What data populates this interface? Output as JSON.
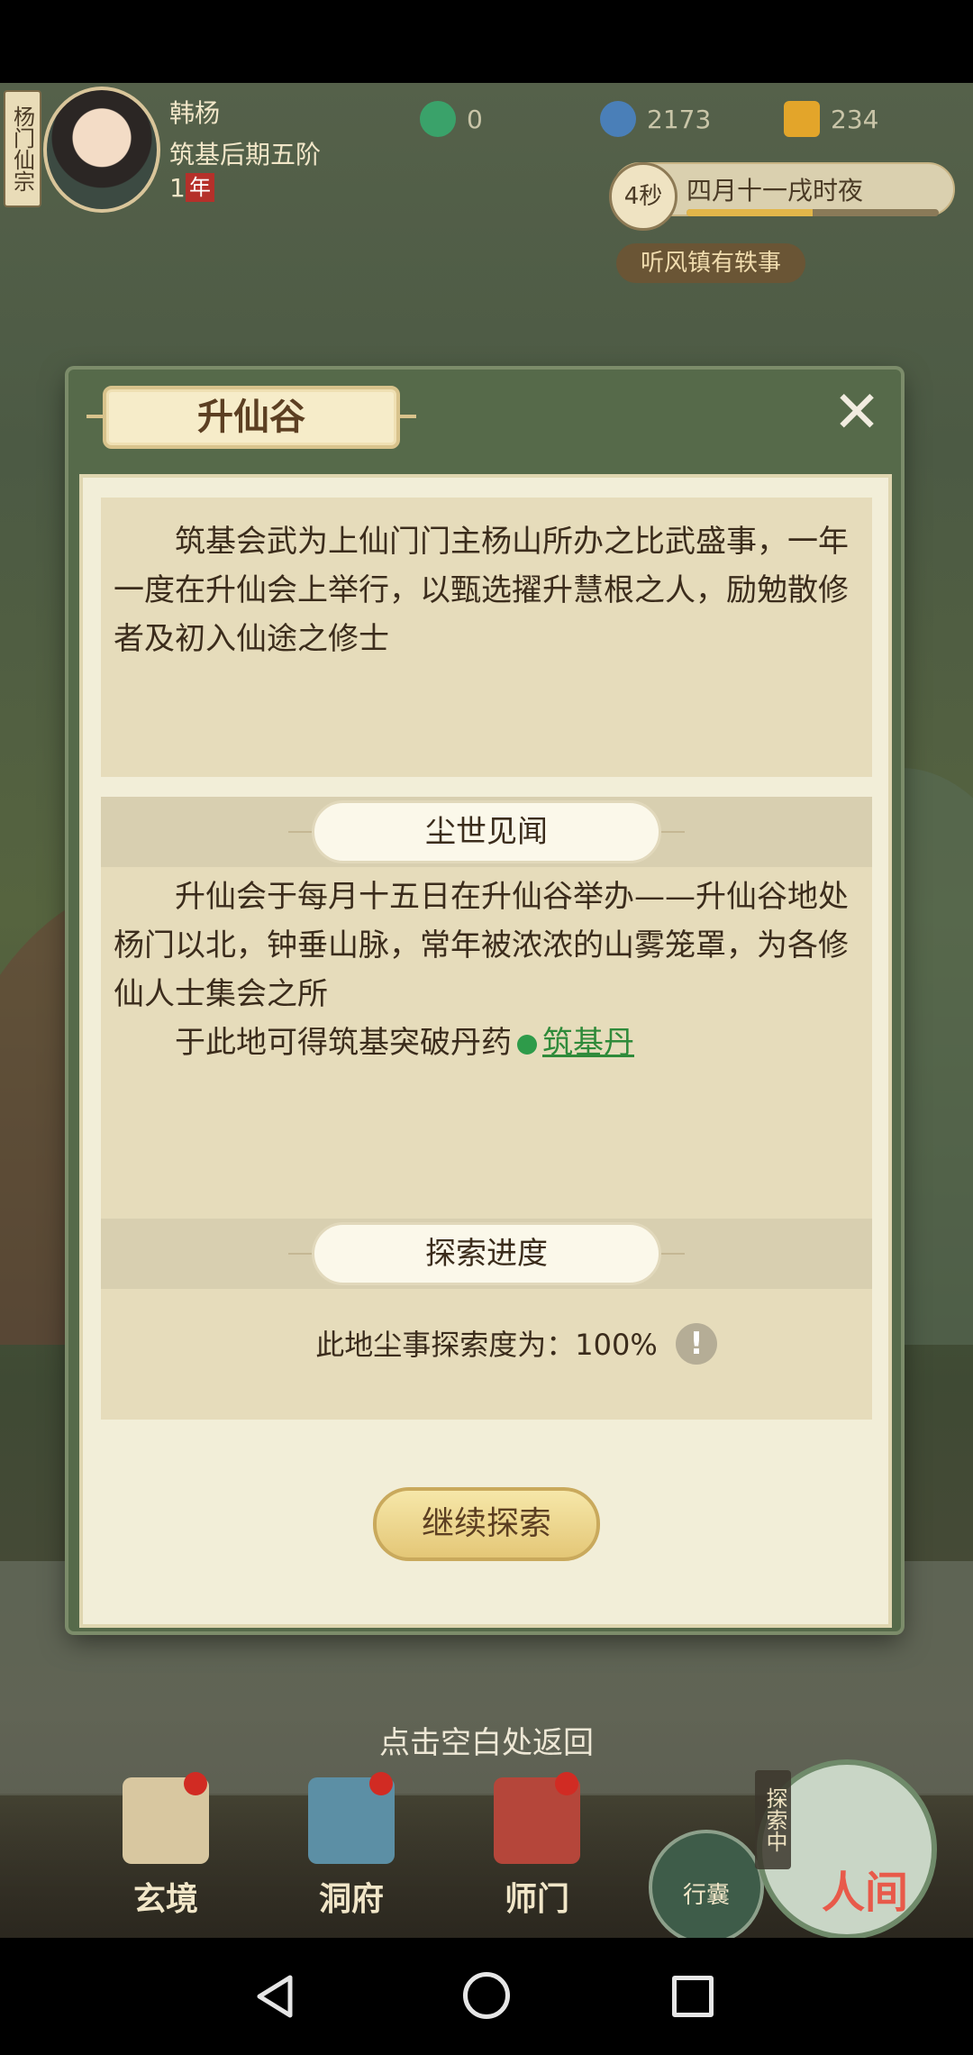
{
  "header": {
    "sect_tag": "杨门仙宗",
    "player_name": "韩杨",
    "player_realm": "筑基后期五阶",
    "player_age_value": "1",
    "player_age_unit": "年",
    "currencies": [
      {
        "icon": "jade-swirl-icon",
        "value": "0",
        "color": "#3aa26a"
      },
      {
        "icon": "coin-icon",
        "value": "2173",
        "color": "#4a7fb8"
      },
      {
        "icon": "gold-ingot-icon",
        "value": "234",
        "color": "#e3a52a"
      }
    ],
    "time_seconds": "4秒",
    "time_text": "四月十一戌时夜",
    "time_progress": 0.5,
    "news_tag": "听风镇有轶事"
  },
  "modal": {
    "title": "升仙谷",
    "close_icon": "✕",
    "intro": "筑基会武为上仙门门主杨山所办之比武盛事，一年一度在升仙会上举行，以甄选擢升慧根之人，励勉散修者及初入仙途之修士",
    "section1_title": "尘世见闻",
    "section1_para1": "升仙会于每月十五日在升仙谷举办——升仙谷地处杨门以北，钟垂山脉，常年被浓浓的山雾笼罩，为各修仙人士集会之所",
    "section1_para2_prefix": "于此地可得筑基突破丹药",
    "section1_link": "筑基丹",
    "section2_title": "探索进度",
    "explore_label": "此地尘事探索度为：100%",
    "info_icon": "!",
    "continue_button": "继续探索"
  },
  "hint": "点击空白处返回",
  "bottom_nav": {
    "items": [
      {
        "label": "玄境",
        "icon": "scroll-icon"
      },
      {
        "label": "洞府",
        "icon": "pavilion-icon"
      },
      {
        "label": "师门",
        "icon": "banner-icon"
      }
    ],
    "bag_label": "行囊",
    "explore_tag": "探索中",
    "world_label": "人间"
  }
}
